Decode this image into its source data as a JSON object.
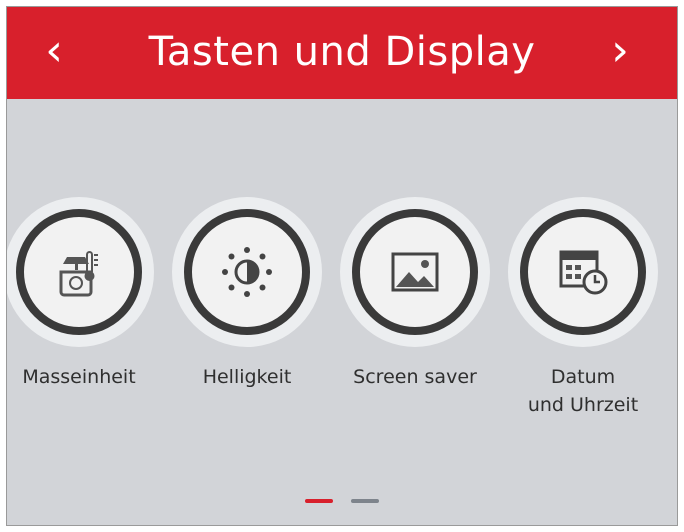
{
  "header": {
    "title": "Tasten und Display",
    "prev_label": "‹",
    "next_label": "›"
  },
  "items": [
    {
      "label": "Masseinheit",
      "icon": "scale-icon"
    },
    {
      "label": "Helligkeit",
      "icon": "brightness-icon"
    },
    {
      "label": "Screen saver",
      "icon": "image-icon"
    },
    {
      "label": "Datum\nund Uhrzeit",
      "icon": "calendar-clock-icon"
    }
  ],
  "pager": {
    "pages": 2,
    "current": 1
  },
  "colors": {
    "accent": "#d8202c",
    "background": "#d2d4d8",
    "ring": "#3a3a3a",
    "text": "#2f2f2f"
  }
}
